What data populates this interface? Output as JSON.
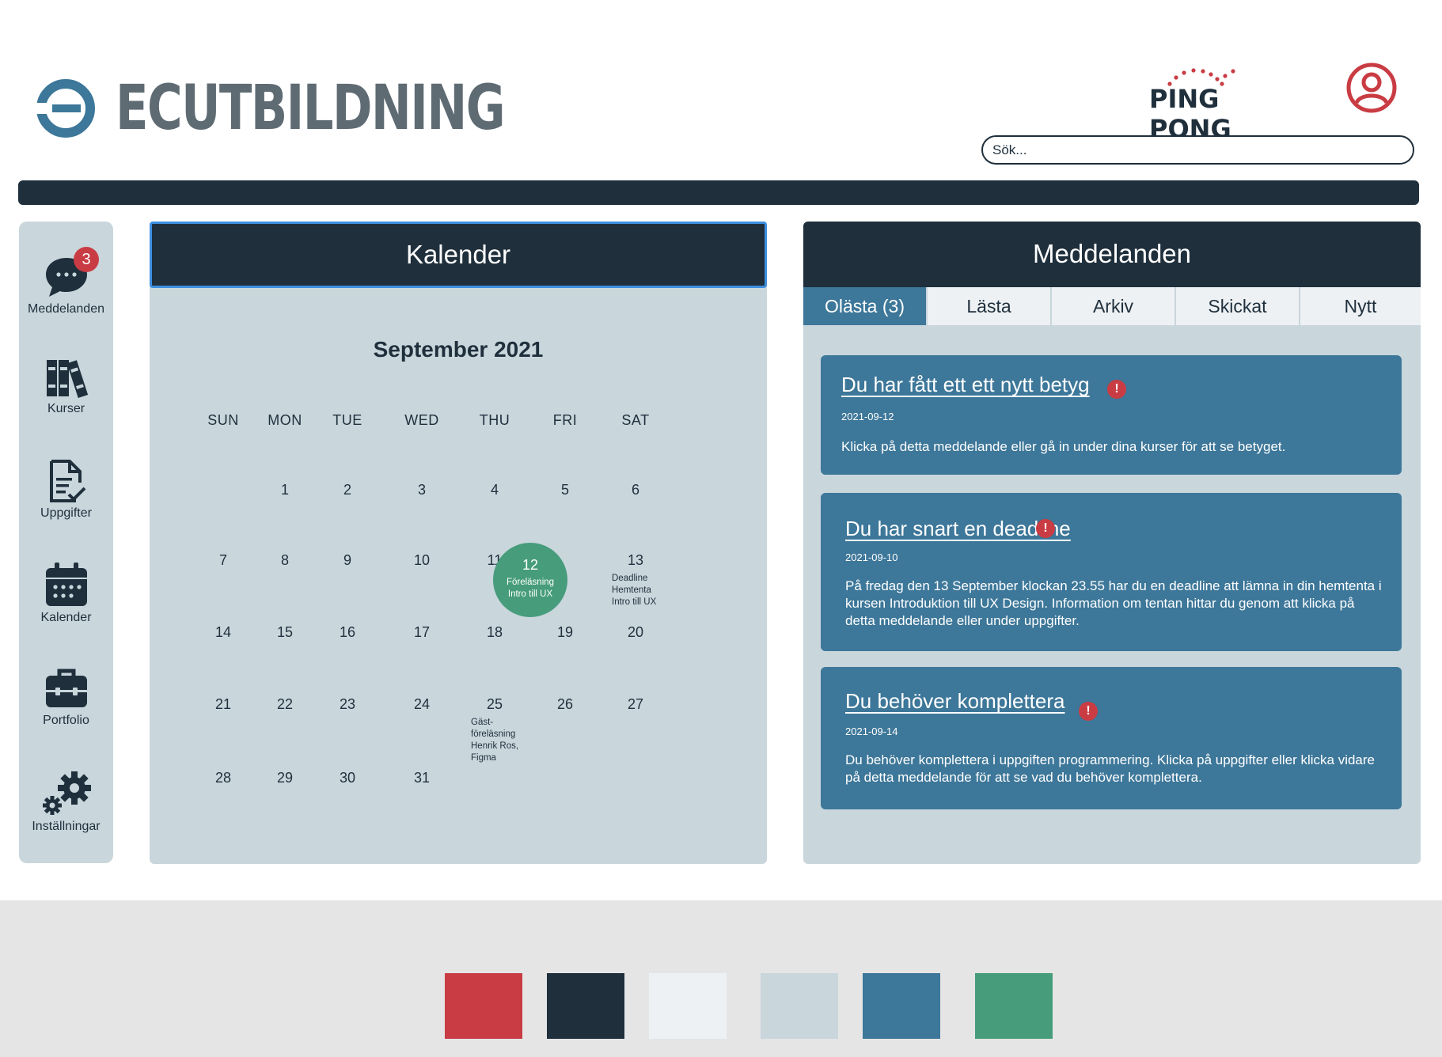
{
  "header": {
    "brand": "ECUTBILDNING",
    "partner": "PING PONG",
    "search_placeholder": "Sök..."
  },
  "colors": {
    "dark": "#1f2f3c",
    "blue": "#3d7799",
    "light": "#c9d6dc",
    "red": "#c93c43",
    "green": "#469c7b",
    "offwhite": "#edf1f3"
  },
  "sidebar": {
    "items": [
      {
        "label": "Meddelanden",
        "icon": "chat-bubble-icon",
        "badge": "3"
      },
      {
        "label": "Kurser",
        "icon": "books-icon"
      },
      {
        "label": "Uppgifter",
        "icon": "document-check-icon"
      },
      {
        "label": "Kalender",
        "icon": "calendar-icon"
      },
      {
        "label": "Portfolio",
        "icon": "briefcase-icon"
      },
      {
        "label": "Inställningar",
        "icon": "gears-icon"
      }
    ]
  },
  "calendar": {
    "title": "Kalender",
    "month": "September 2021",
    "weekdays": [
      "SUN",
      "MON",
      "TUE",
      "WED",
      "THU",
      "FRI",
      "SAT"
    ],
    "days": [
      "1",
      "2",
      "3",
      "4",
      "5",
      "6",
      "7",
      "8",
      "9",
      "10",
      "11",
      "12",
      "13",
      "14",
      "15",
      "16",
      "17",
      "18",
      "19",
      "20",
      "21",
      "22",
      "23",
      "24",
      "25",
      "26",
      "27",
      "28",
      "29",
      "30",
      "31"
    ],
    "events": {
      "12": [
        "Föreläsning",
        "Intro till UX"
      ],
      "13": [
        "Deadline",
        "Hemtenta",
        "Intro till UX"
      ],
      "25": [
        "Gäst-",
        "föreläsning",
        "Henrik Ros,",
        "Figma"
      ]
    }
  },
  "messages": {
    "title": "Meddelanden",
    "tabs": [
      "Olästa (3)",
      "Lästa",
      "Arkiv",
      "Skickat",
      "Nytt"
    ],
    "active_tab": "Olästa (3)",
    "items": [
      {
        "title": "Du har fått ett ett nytt betyg",
        "date": "2021-09-12",
        "body": "Klicka på detta meddelande eller gå in under dina kurser för att se betyget."
      },
      {
        "title": "Du har snart en deadline",
        "date": "2021-09-10",
        "body": "På fredag den 13 September klockan 23.55 har du en deadline att lämna in din hemtenta i kursen Introduktion till UX Design. Information om tentan hittar du genom att klicka på detta meddelande eller under uppgifter."
      },
      {
        "title": "Du behöver komplettera",
        "date": "2021-09-14",
        "body": "Du behöver komplettera i uppgiften programmering. Klicka på uppgifter eller klicka vidare på detta meddelande för att se vad du behöver komplettera."
      }
    ],
    "alert_symbol": "!"
  },
  "palette": [
    "#c93c43",
    "#1f2f3c",
    "#edf1f3",
    "#c9d6dc",
    "#3d7799",
    "#469c7b"
  ]
}
